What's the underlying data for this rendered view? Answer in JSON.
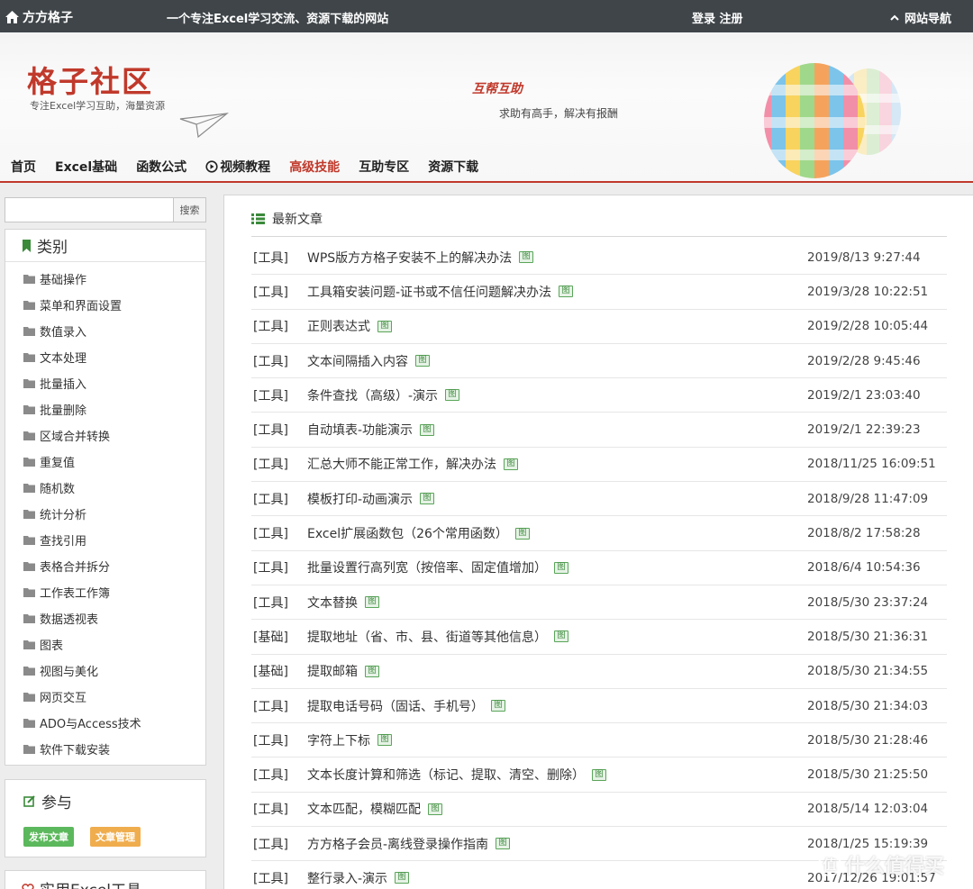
{
  "topbar": {
    "brand": "方方格子",
    "slogan": "一个专注Excel学习交流、资源下载的网站",
    "auth": "登录 注册",
    "sitenav": "网站导航"
  },
  "banner": {
    "title": "格子社区",
    "subtitle": "专注Excel学习互助，海量资源",
    "motto": "互帮互助",
    "motto_sub": "求助有高手，解决有报酬"
  },
  "nav": {
    "items": [
      "首页",
      "Excel基础",
      "函数公式",
      "视频教程",
      "高级技能",
      "互助专区",
      "资源下载"
    ],
    "active": "高级技能"
  },
  "search": {
    "button": "搜索",
    "placeholder": ""
  },
  "categories": {
    "title": "类别",
    "items": [
      "基础操作",
      "菜单和界面设置",
      "数值录入",
      "文本处理",
      "批量插入",
      "批量删除",
      "区域合并转换",
      "重复值",
      "随机数",
      "统计分析",
      "查找引用",
      "表格合并拆分",
      "工作表工作簿",
      "数据透视表",
      "图表",
      "视图与美化",
      "网页交互",
      "ADO与Access技术",
      "软件下载安装"
    ]
  },
  "join": {
    "title": "参与",
    "publish": "发布文章",
    "manage": "文章管理"
  },
  "tools": {
    "title": "实用Excel工具"
  },
  "articles": {
    "title": "最新文章",
    "image_badge": "图",
    "rows": [
      {
        "cat": "[工具]",
        "title": "WPS版方方格子安装不上的解决办法",
        "date": "2019/8/13 9:27:44"
      },
      {
        "cat": "[工具]",
        "title": "工具箱安装问题-证书或不信任问题解决办法",
        "date": "2019/3/28 10:22:51"
      },
      {
        "cat": "[工具]",
        "title": "正则表达式",
        "date": "2019/2/28 10:05:44"
      },
      {
        "cat": "[工具]",
        "title": "文本间隔插入内容",
        "date": "2019/2/28 9:45:46"
      },
      {
        "cat": "[工具]",
        "title": "条件查找（高级）-演示",
        "date": "2019/2/1 23:03:40"
      },
      {
        "cat": "[工具]",
        "title": "自动填表-功能演示",
        "date": "2019/2/1 22:39:23"
      },
      {
        "cat": "[工具]",
        "title": "汇总大师不能正常工作，解决办法",
        "date": "2018/11/25 16:09:51"
      },
      {
        "cat": "[工具]",
        "title": "模板打印-动画演示",
        "date": "2018/9/28 11:47:09"
      },
      {
        "cat": "[工具]",
        "title": "Excel扩展函数包（26个常用函数）",
        "date": "2018/8/2 17:58:28"
      },
      {
        "cat": "[工具]",
        "title": "批量设置行高列宽（按倍率、固定值增加）",
        "date": "2018/6/4 10:54:36"
      },
      {
        "cat": "[工具]",
        "title": "文本替换",
        "date": "2018/5/30 23:37:24"
      },
      {
        "cat": "[基础]",
        "title": "提取地址（省、市、县、街道等其他信息）",
        "date": "2018/5/30 21:36:31"
      },
      {
        "cat": "[基础]",
        "title": "提取邮箱",
        "date": "2018/5/30 21:34:55"
      },
      {
        "cat": "[工具]",
        "title": "提取电话号码（固话、手机号）",
        "date": "2018/5/30 21:34:03"
      },
      {
        "cat": "[工具]",
        "title": "字符上下标",
        "date": "2018/5/30 21:28:46"
      },
      {
        "cat": "[工具]",
        "title": "文本长度计算和筛选（标记、提取、清空、删除）",
        "date": "2018/5/30 21:25:50"
      },
      {
        "cat": "[工具]",
        "title": "文本匹配，模糊匹配",
        "date": "2018/5/14 12:03:04"
      },
      {
        "cat": "[工具]",
        "title": "方方格子会员-离线登录操作指南",
        "date": "2018/1/25 15:19:39"
      },
      {
        "cat": "[工具]",
        "title": "整行录入-演示",
        "date": "2017/12/26 19:01:57"
      }
    ]
  },
  "watermark": {
    "badge": "值",
    "text": "什么值得买"
  },
  "colors": {
    "accent": "#c0392b",
    "topbar": "#3f4549",
    "green": "#5cb85c",
    "orange": "#f0ad4e"
  }
}
